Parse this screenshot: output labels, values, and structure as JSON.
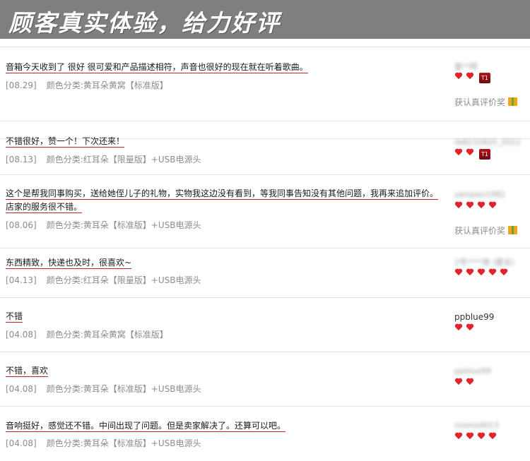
{
  "banner": {
    "title": "顾客真实体验，给力好评"
  },
  "reviews": [
    {
      "comment": "音箱今天收到了 很好 很可爱和产品描述相符，声音也很好的现在就在听着歌曲。",
      "date": "[08.29]",
      "variant": "颜色分类:黄耳朵黄窝【标准版】",
      "user": "雷**晖",
      "hearts": 2,
      "badge": "T1",
      "reward": "获认真评价奖"
    },
    {
      "comment": "不错很好，赞一个！下次还来！",
      "date": "[08.13]",
      "variant": "颜色分类:红耳朵【限量版】+USB电源头",
      "user": "tb8232820_2012",
      "hearts": 2,
      "badge": "T1"
    },
    {
      "comment": "这个是帮我同事购买，送给她侄儿子的礼物，实物我这边没有看到，等我同事告知没有其他问题，我再来追加评价。",
      "comment2": "店家的服务很不错。",
      "date": "[08.06]",
      "variant": "颜色分类:黄耳朵【标准版】+USB电源头",
      "user": "yanqiao1982",
      "hearts": 4,
      "reward": "获认真评价奖"
    },
    {
      "comment": "东西精致，快递也及时，很喜欢~",
      "date": "[04.13]",
      "variant": "颜色分类:红耳朵【限量版】+USB电源头",
      "user": "2号****库 (匿名)",
      "hearts": 5
    },
    {
      "comment": "不错",
      "date": "[04.08]",
      "variant": "颜色分类:黄耳朵黄窝【标准版】",
      "user": "ppblue99",
      "hearts": 2
    },
    {
      "comment": "不错，喜欢",
      "date": "[04.08]",
      "variant": "颜色分类:黄耳朵【标准版】+USB电源头",
      "user": "ppblue99",
      "hearts": 2
    },
    {
      "comment": "音响挺好，感觉还不错。中间出现了问题。但是卖家解决了。还算可以吧。",
      "date": "[04.08]",
      "variant": "颜色分类:黄耳朵【标准版】+USB电源头",
      "user": "momo4013",
      "hearts": 4
    }
  ],
  "colors": {
    "banner_bg": "#7f7f7f",
    "heart": "#e0242c",
    "underline": "#c8232c",
    "meta_text": "#8c8c8c"
  }
}
